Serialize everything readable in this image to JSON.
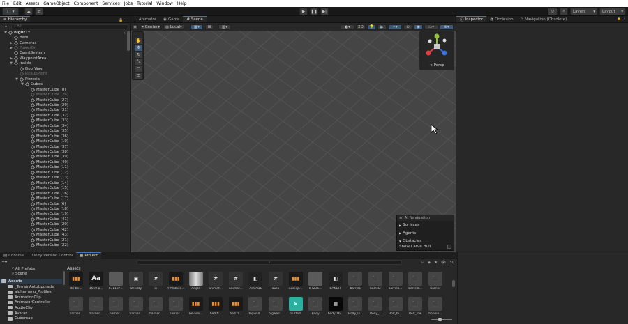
{
  "menu": [
    "File",
    "Edit",
    "Assets",
    "GameObject",
    "Component",
    "Services",
    "Jobs",
    "Tutorial",
    "Window",
    "Help"
  ],
  "toolbar": {
    "account": "TT",
    "layers": "Layers",
    "layout": "Layout"
  },
  "hierarchy": {
    "tab": "Hierarchy",
    "search_placeholder": "All",
    "rows": [
      {
        "label": "night1*",
        "indent": 0,
        "arrow": "▼",
        "dim": false,
        "icon": "scene-icon"
      },
      {
        "label": "Bam",
        "indent": 1,
        "arrow": "",
        "dim": false
      },
      {
        "label": "Cameras",
        "indent": 1,
        "arrow": "▶",
        "dim": false
      },
      {
        "label": "PowerOn",
        "indent": 1,
        "arrow": "▶",
        "dim": true
      },
      {
        "label": "EventSystem",
        "indent": 1,
        "arrow": "",
        "dim": false
      },
      {
        "label": "WaypointArea",
        "indent": 1,
        "arrow": "▶",
        "dim": false
      },
      {
        "label": "Inside",
        "indent": 1,
        "arrow": "▼",
        "dim": false
      },
      {
        "label": "DoorWay",
        "indent": 2,
        "arrow": "",
        "dim": false
      },
      {
        "label": "PickupPoint",
        "indent": 2,
        "arrow": "",
        "dim": true
      },
      {
        "label": "Pizzeria",
        "indent": 2,
        "arrow": "▼",
        "dim": false
      },
      {
        "label": "Cubes",
        "indent": 3,
        "arrow": "▼",
        "dim": false
      },
      {
        "label": "MasterCube (8)",
        "indent": 4,
        "arrow": "",
        "dim": false
      },
      {
        "label": "MasterCube (26)",
        "indent": 4,
        "arrow": "",
        "dim": true
      },
      {
        "label": "MasterCube (27)",
        "indent": 4,
        "arrow": "",
        "dim": false
      },
      {
        "label": "MasterCube (29)",
        "indent": 4,
        "arrow": "",
        "dim": false
      },
      {
        "label": "MasterCube (31)",
        "indent": 4,
        "arrow": "",
        "dim": false
      },
      {
        "label": "MasterCube (32)",
        "indent": 4,
        "arrow": "",
        "dim": false
      },
      {
        "label": "MasterCube (33)",
        "indent": 4,
        "arrow": "",
        "dim": false
      },
      {
        "label": "MasterCube (34)",
        "indent": 4,
        "arrow": "",
        "dim": false
      },
      {
        "label": "MasterCube (35)",
        "indent": 4,
        "arrow": "",
        "dim": false
      },
      {
        "label": "MasterCube (36)",
        "indent": 4,
        "arrow": "",
        "dim": false
      },
      {
        "label": "MasterCube (10)",
        "indent": 4,
        "arrow": "",
        "dim": false
      },
      {
        "label": "MasterCube (37)",
        "indent": 4,
        "arrow": "",
        "dim": false
      },
      {
        "label": "MasterCube (38)",
        "indent": 4,
        "arrow": "",
        "dim": false
      },
      {
        "label": "MasterCube (39)",
        "indent": 4,
        "arrow": "",
        "dim": false
      },
      {
        "label": "MasterCube (40)",
        "indent": 4,
        "arrow": "",
        "dim": false
      },
      {
        "label": "MasterCube (11)",
        "indent": 4,
        "arrow": "",
        "dim": false
      },
      {
        "label": "MasterCube (12)",
        "indent": 4,
        "arrow": "",
        "dim": false
      },
      {
        "label": "MasterCube (13)",
        "indent": 4,
        "arrow": "",
        "dim": false
      },
      {
        "label": "MasterCube (14)",
        "indent": 4,
        "arrow": "",
        "dim": false
      },
      {
        "label": "MasterCube (15)",
        "indent": 4,
        "arrow": "",
        "dim": false
      },
      {
        "label": "MasterCube (16)",
        "indent": 4,
        "arrow": "",
        "dim": false
      },
      {
        "label": "MasterCube (17)",
        "indent": 4,
        "arrow": "",
        "dim": false
      },
      {
        "label": "MasterCube (6)",
        "indent": 4,
        "arrow": "",
        "dim": false
      },
      {
        "label": "MasterCube (18)",
        "indent": 4,
        "arrow": "",
        "dim": false
      },
      {
        "label": "MasterCube (19)",
        "indent": 4,
        "arrow": "",
        "dim": false
      },
      {
        "label": "MasterCube (41)",
        "indent": 4,
        "arrow": "",
        "dim": false
      },
      {
        "label": "MasterCube (20)",
        "indent": 4,
        "arrow": "",
        "dim": false
      },
      {
        "label": "MasterCube (42)",
        "indent": 4,
        "arrow": "",
        "dim": false
      },
      {
        "label": "MasterCube (43)",
        "indent": 4,
        "arrow": "",
        "dim": false
      },
      {
        "label": "MasterCube (21)",
        "indent": 4,
        "arrow": "",
        "dim": false
      },
      {
        "label": "MasterCube (22)",
        "indent": 4,
        "arrow": "",
        "dim": false
      }
    ]
  },
  "center_tabs": [
    "Animator",
    "Game",
    "Scene"
  ],
  "scene_toolbar": {
    "pivot": "Center",
    "space": "Local",
    "mode_2d": "2D"
  },
  "scene_gizmo": {
    "label": "< Persp"
  },
  "ai_nav": {
    "title": "AI Navigation",
    "items": [
      "Surfaces",
      "Agents",
      "Obstacles"
    ],
    "toggle_label": "Show Carve Hull"
  },
  "right_tabs": [
    "Inspector",
    "Occlusion",
    "Navigation (Obsolete)"
  ],
  "bottom_tabs": [
    "Console",
    "Unity Version Control",
    "Project"
  ],
  "project": {
    "search_placeholder": "",
    "icon_count": "30",
    "tree": [
      {
        "label": "All Prefabs",
        "indent": 1,
        "icon": "search"
      },
      {
        "label": "Scene",
        "indent": 1,
        "icon": "search"
      },
      {
        "label": "Assets",
        "indent": 0,
        "icon": "folder",
        "bold": true
      },
      {
        "label": "_TerrainAutoUpgrade",
        "indent": 1,
        "icon": "folder"
      },
      {
        "label": "alphamenu_Profiles",
        "indent": 1,
        "icon": "folder"
      },
      {
        "label": "AnimationClip",
        "indent": 1,
        "icon": "folder"
      },
      {
        "label": "AnimatorController",
        "indent": 1,
        "icon": "folder"
      },
      {
        "label": "AudioClip",
        "indent": 1,
        "icon": "folder"
      },
      {
        "label": "Avatar",
        "indent": 1,
        "icon": "folder"
      },
      {
        "label": "Cubemap",
        "indent": 1,
        "icon": "folder"
      }
    ],
    "breadcrumb": "Assets",
    "row1": [
      {
        "label": "4h-be...",
        "kind": "audio"
      },
      {
        "label": "1560 p...",
        "kind": "font"
      },
      {
        "label": "071187...",
        "kind": "gray"
      },
      {
        "label": "afreddy",
        "kind": "prefab"
      },
      {
        "label": "ai",
        "kind": "script"
      },
      {
        "label": "// Ambien...",
        "kind": "audio"
      },
      {
        "label": "Angle",
        "kind": "material"
      },
      {
        "label": "animat...",
        "kind": "script"
      },
      {
        "label": "Animat...",
        "kind": "script"
      },
      {
        "label": "ARCADE",
        "kind": "dark"
      },
      {
        "label": "auck",
        "kind": "script"
      },
      {
        "label": "audiop...",
        "kind": "audio"
      },
      {
        "label": "b7235...",
        "kind": "gray"
      },
      {
        "label": "BANDIT",
        "kind": "dark"
      },
      {
        "label": "barrel1",
        "kind": "model"
      },
      {
        "label": "barrel2",
        "kind": "model"
      },
      {
        "label": "barrelb...",
        "kind": "model"
      },
      {
        "label": "barrelb...",
        "kind": "model"
      },
      {
        "label": "barrier",
        "kind": "model"
      }
    ],
    "row2": [
      {
        "label": "barrier...",
        "kind": "model"
      },
      {
        "label": "barrier...",
        "kind": "model"
      },
      {
        "label": "barrier...",
        "kind": "model"
      },
      {
        "label": "barrier...",
        "kind": "model"
      },
      {
        "label": "barrier...",
        "kind": "model"
      },
      {
        "label": "barrier...",
        "kind": "model"
      },
      {
        "label": "be-adv...",
        "kind": "audio"
      },
      {
        "label": "bed fr...",
        "kind": "audio"
      },
      {
        "label": "bed fr...",
        "kind": "audio"
      },
      {
        "label": "bigwall...",
        "kind": "model"
      },
      {
        "label": "bigwall...",
        "kind": "model"
      },
      {
        "label": "blurtest",
        "kind": "shader"
      },
      {
        "label": "Body",
        "kind": "model"
      },
      {
        "label": "body 16...",
        "kind": "black"
      },
      {
        "label": "Body_D...",
        "kind": "model"
      },
      {
        "label": "Body_1",
        "kind": "model"
      },
      {
        "label": "Bolt_bi...",
        "kind": "model"
      },
      {
        "label": "Bolt_low",
        "kind": "model"
      },
      {
        "label": "bonnie...",
        "kind": "model"
      }
    ]
  }
}
